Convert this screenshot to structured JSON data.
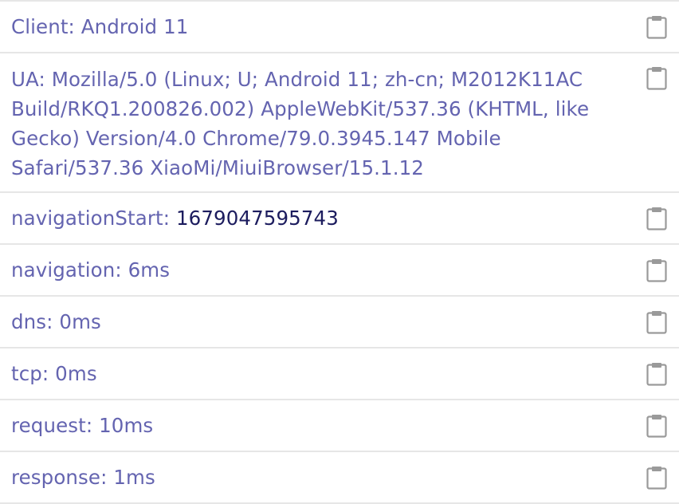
{
  "rows": [
    {
      "label": "Client: ",
      "value": "Android 11"
    },
    {
      "label": "UA: ",
      "value": "Mozilla/5.0 (Linux; U; Android 11; zh-cn; M2012K11AC Build/RKQ1.200826.002) AppleWebKit/537.36 (KHTML, like Gecko) Version/4.0 Chrome/79.0.3945.147 Mobile Safari/537.36 XiaoMi/MiuiBrowser/15.1.12"
    },
    {
      "label": "navigationStart: ",
      "value": "1679047595743"
    },
    {
      "label": "navigation: ",
      "value": "6ms"
    },
    {
      "label": "dns: ",
      "value": "0ms"
    },
    {
      "label": "tcp: ",
      "value": "0ms"
    },
    {
      "label": "request: ",
      "value": "10ms"
    },
    {
      "label": "response: ",
      "value": "1ms"
    }
  ],
  "icon": "clipboard-icon",
  "colors": {
    "text": "#6464b0",
    "value_dark": "#1c1c5e",
    "divider": "#e6e6e6",
    "icon": "#9a9a9a"
  }
}
